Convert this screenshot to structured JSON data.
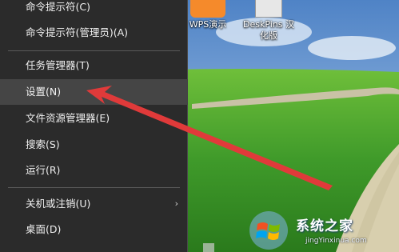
{
  "desktop_icons": [
    {
      "label": "WPS演示",
      "icon": "wps-presentation-icon"
    },
    {
      "label": "DeskPins 汉\n化版",
      "icon": "deskpins-icon"
    }
  ],
  "menu": {
    "items": [
      {
        "label": "命令提示符(C)"
      },
      {
        "label": "命令提示符(管理员)(A)"
      },
      {
        "label": "任务管理器(T)"
      },
      {
        "label": "设置(N)",
        "highlighted": true
      },
      {
        "label": "文件资源管理器(E)"
      },
      {
        "label": "搜索(S)"
      },
      {
        "label": "运行(R)"
      },
      {
        "label": "关机或注销(U)",
        "has_submenu": true
      },
      {
        "label": "桌面(D)"
      }
    ],
    "submenu_glyph": "›"
  },
  "annotation": {
    "type": "red-arrow",
    "color": "#e03a3a",
    "points_to": "设置(N)"
  },
  "watermark": {
    "text": "系统之家",
    "url": "jingYinxinua.com",
    "logo": "windows-logo-icon"
  },
  "colors": {
    "menu_bg": "#2b2b2b",
    "menu_hover": "#454545",
    "grass": "#3f9a2a",
    "sky": "#6f9bd0"
  }
}
